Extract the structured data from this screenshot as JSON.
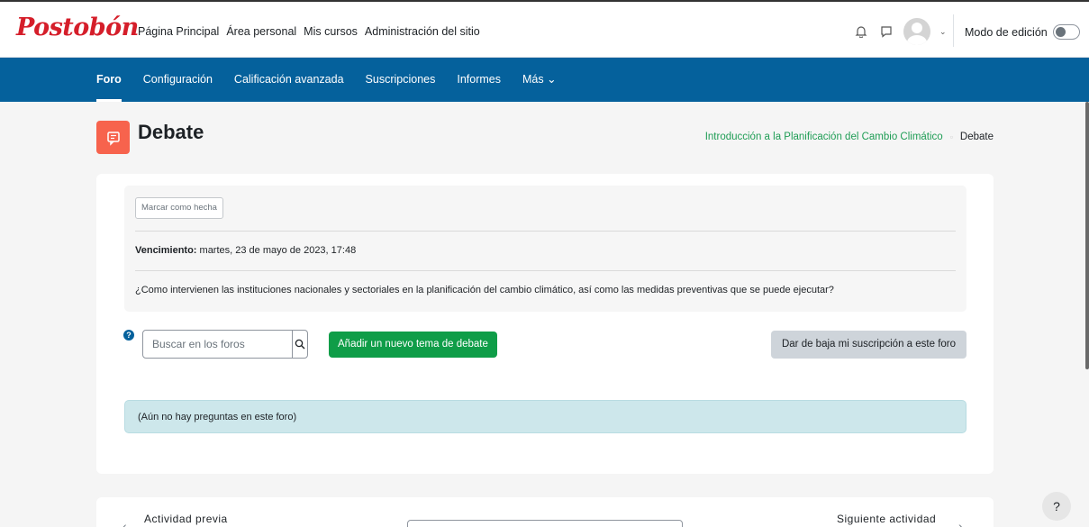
{
  "brand": {
    "logo_text": "Postobón",
    "accent": "#05619c",
    "success": "#0f9d48",
    "activity_color": "#f7634d"
  },
  "topnav": [
    "Página Principal",
    "Área personal",
    "Mis cursos",
    "Administración del sitio"
  ],
  "user_area": {
    "edit_mode_label": "Modo de edición",
    "edit_mode_on": false,
    "icons": [
      "bell-icon",
      "chat-icon",
      "avatar",
      "chevron-down-icon"
    ]
  },
  "secondary_nav": {
    "items": [
      "Foro",
      "Configuración",
      "Calificación avanzada",
      "Suscripciones",
      "Informes",
      "Más"
    ],
    "active": "Foro"
  },
  "page": {
    "title": "Debate",
    "breadcrumb": [
      "Introducción a la Planificación del Cambio Climático",
      "Debate"
    ]
  },
  "info": {
    "mark_done_label": "Marcar como hecha",
    "due_label": "Vencimiento:",
    "due_value": " martes, 23 de mayo de 2023, 17:48",
    "question": "¿Como intervienen las instituciones nacionales y sectoriales en la planificación del cambio climático, así como las medidas preventivas que se puede ejecutar?"
  },
  "actions": {
    "search_placeholder": "Buscar en los foros",
    "add_topic_label": "Añadir un nuevo tema de debate",
    "unsubscribe_label": "Dar de baja mi suscripción a este foro"
  },
  "notice": "(Aún no hay preguntas en este foro)",
  "activity_nav": {
    "prev_label": "Actividad previa",
    "next_label": "Siguiente actividad"
  },
  "help_label": "?"
}
